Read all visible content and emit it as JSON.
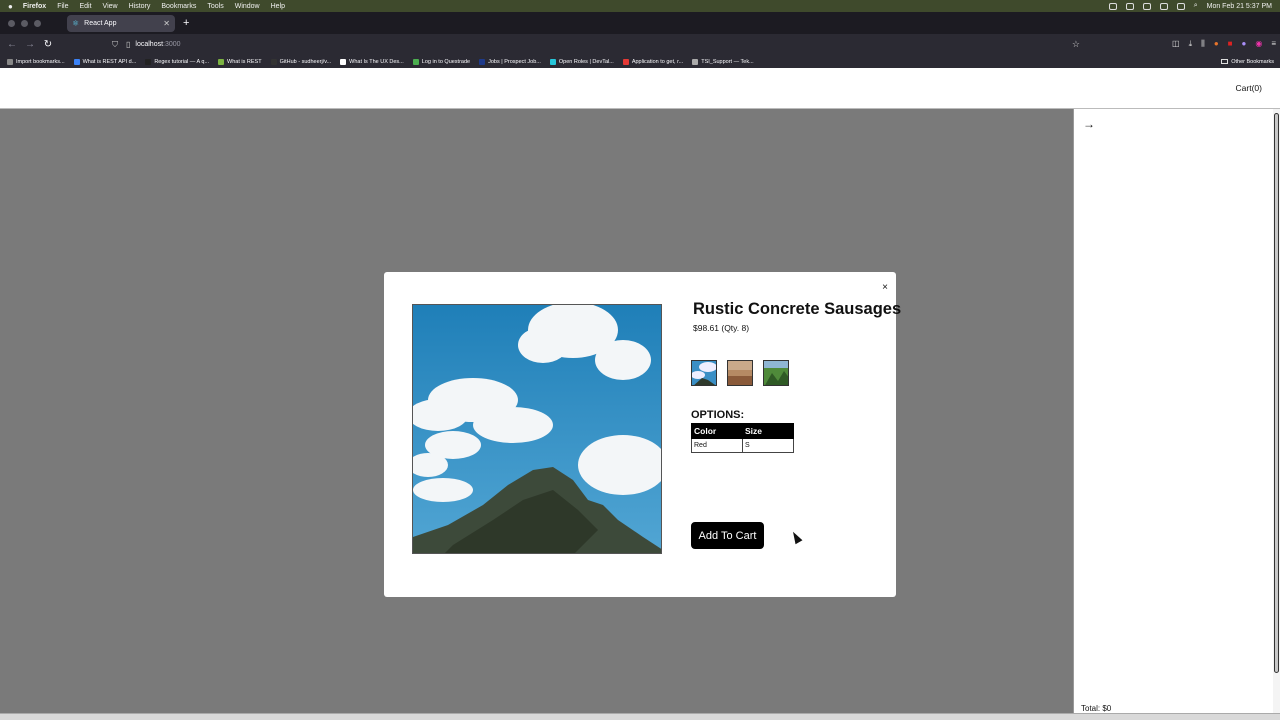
{
  "menubar": {
    "app": "Firefox",
    "items": [
      "File",
      "Edit",
      "View",
      "History",
      "Bookmarks",
      "Tools",
      "Window",
      "Help"
    ],
    "datetime": "Mon Feb 21  5:37 PM"
  },
  "browser": {
    "tab_title": "React App",
    "new_tab": "+",
    "url_host": "localhost",
    "url_port": ":3000"
  },
  "bookmarks": {
    "items": [
      {
        "label": "Import bookmarks...",
        "color": "#888888"
      },
      {
        "label": "What is REST API d...",
        "color": "#3b82f6"
      },
      {
        "label": "Regex tutorial — A q...",
        "color": "#222222"
      },
      {
        "label": "What is REST",
        "color": "#7cb342"
      },
      {
        "label": "GitHub - sudheerj/v...",
        "color": "#333333"
      },
      {
        "label": "What Is The UX Des...",
        "color": "#ffffff"
      },
      {
        "label": "Log in to Questrade",
        "color": "#4caf50"
      },
      {
        "label": "Jobs | Prospect Job...",
        "color": "#1e3a8a"
      },
      {
        "label": "Open Roles | DevTal...",
        "color": "#26c6da"
      },
      {
        "label": "Application to get, r...",
        "color": "#e53935"
      },
      {
        "label": "TSI_Support — Tek...",
        "color": "#aaaaaa"
      }
    ],
    "other": "Other Bookmarks"
  },
  "header": {
    "cart_label": "Cart(0)"
  },
  "drawer": {
    "arrow": "→",
    "total": "Total: $0"
  },
  "modal": {
    "close": "×",
    "title": "Rustic Concrete Sausages",
    "price": "$98.61 (Qty. 8)",
    "options_label": "OPTIONS:",
    "options_table": {
      "headers": [
        "Color",
        "Size"
      ],
      "rows": [
        [
          "Red",
          "S"
        ]
      ]
    },
    "add_to_cart": "Add To Cart"
  }
}
